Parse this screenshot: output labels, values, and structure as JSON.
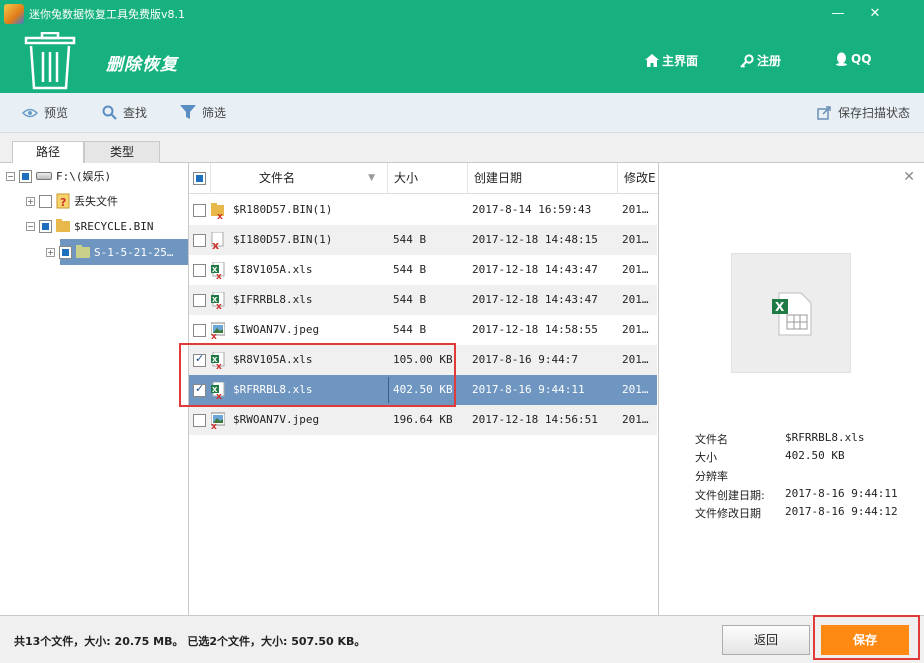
{
  "window": {
    "title": "迷你兔数据恢复工具免费版v8.1",
    "minimize": "—",
    "close": "✕"
  },
  "header": {
    "module_title": "删除恢复",
    "links": {
      "home": "主界面",
      "register": "注册",
      "qq": "QQ"
    }
  },
  "toolbar": {
    "preview": "预览",
    "find": "查找",
    "filter": "筛选",
    "save_scan": "保存扫描状态"
  },
  "tabs": {
    "path": "路径",
    "type": "类型"
  },
  "tree": {
    "root": "F:\\(娱乐)",
    "lost_files": "丢失文件",
    "recycle_bin": "$RECYCLE.BIN",
    "sid_folder": "S-1-5-21-25…"
  },
  "list": {
    "headers": {
      "name": "文件名",
      "size": "大小",
      "created": "创建日期",
      "modified": "修改E"
    },
    "rows": [
      {
        "name": "$R180D57.BIN(1)",
        "size": "",
        "created": "2017-8-14 16:59:43",
        "modified": "201…",
        "checked": false,
        "icon": "folder-deleted-icon"
      },
      {
        "name": "$I180D57.BIN(1)",
        "size": "544 B",
        "created": "2017-12-18 14:48:15",
        "modified": "201…",
        "checked": false,
        "icon": "file-deleted-icon"
      },
      {
        "name": "$I8V105A.xls",
        "size": "544 B",
        "created": "2017-12-18 14:43:47",
        "modified": "201…",
        "checked": false,
        "icon": "excel-deleted-icon"
      },
      {
        "name": "$IFRRBL8.xls",
        "size": "544 B",
        "created": "2017-12-18 14:43:47",
        "modified": "201…",
        "checked": false,
        "icon": "excel-deleted-icon"
      },
      {
        "name": "$IWOAN7V.jpeg",
        "size": "544 B",
        "created": "2017-12-18 14:58:55",
        "modified": "201…",
        "checked": false,
        "icon": "image-deleted-icon"
      },
      {
        "name": "$R8V105A.xls",
        "size": "105.00 KB",
        "created": "2017-8-16 9:44:7",
        "modified": "201…",
        "checked": true,
        "icon": "excel-deleted-icon"
      },
      {
        "name": "$RFRRBL8.xls",
        "size": "402.50 KB",
        "created": "2017-8-16 9:44:11",
        "modified": "201…",
        "checked": true,
        "icon": "excel-deleted-icon"
      },
      {
        "name": "$RWOAN7V.jpeg",
        "size": "196.64 KB",
        "created": "2017-12-18 14:56:51",
        "modified": "201…",
        "checked": false,
        "icon": "image-deleted-icon"
      }
    ]
  },
  "preview": {
    "labels": {
      "name": "文件名",
      "size": "大小",
      "resolution": "分辨率",
      "created": "文件创建日期:",
      "modified": "文件修改日期"
    },
    "values": {
      "name": "$RFRRBL8.xls",
      "size": "402.50 KB",
      "resolution": "",
      "created": "2017-8-16 9:44:11",
      "modified": "2017-8-16 9:44:12"
    }
  },
  "status": {
    "summary": "共13个文件，大小: 20.75 MB。 已选2个文件，大小: 507.50 KB。",
    "back": "返回",
    "save": "保存"
  },
  "colors": {
    "brand": "#16b17e",
    "selected_row": "#6f96c1",
    "save_button": "#ff8a13",
    "highlight": "#e03a3a"
  }
}
